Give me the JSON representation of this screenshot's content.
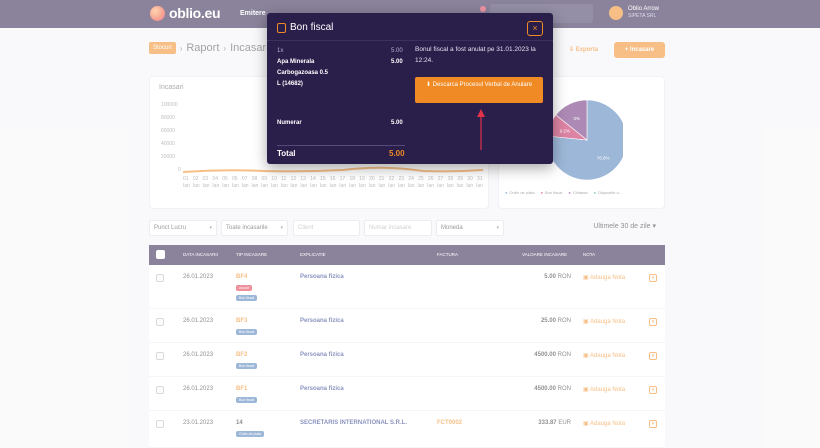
{
  "app": {
    "logo_text": "oblio.eu"
  },
  "nav": {
    "emitere": "Emitere"
  },
  "user": {
    "name": "Oblio Arrow",
    "company": "SIPETA SRL"
  },
  "breadcrumb": {
    "tag": "Stocuri",
    "items": [
      "Raport",
      "Incasari"
    ]
  },
  "toolbar": {
    "export_label": "Exporta",
    "add_label": "+ Incasare"
  },
  "chart_card": {
    "title": "Incasari"
  },
  "chart_data": [
    {
      "type": "area",
      "title": "Incasari",
      "y_ticks": [
        "100000",
        "80000",
        "60000",
        "40000",
        "20000",
        "0"
      ],
      "x_ticks": [
        "01",
        "02",
        "03",
        "04",
        "05",
        "06",
        "07",
        "08",
        "09",
        "10",
        "11",
        "12",
        "13",
        "14",
        "15",
        "16",
        "17",
        "18",
        "19",
        "20",
        "21",
        "22",
        "23",
        "24",
        "25",
        "26",
        "27",
        "28",
        "29",
        "30",
        "31"
      ],
      "x_subticks": [
        "Ian",
        "Ian",
        "Ian",
        "Ian",
        "Ian",
        "Ian",
        "Ian",
        "Ian",
        "Ian",
        "Ian",
        "Ian",
        "Ian",
        "Ian",
        "Ian",
        "Ian",
        "Ian",
        "Ian",
        "Ian",
        "Ian",
        "Ian",
        "Ian",
        "Ian",
        "Ian",
        "Ian",
        "Ian",
        "Ian",
        "Ian",
        "Ian",
        "Ian",
        "Ian",
        "Ian"
      ],
      "ylim": [
        0,
        100000
      ]
    },
    {
      "type": "pie",
      "slices": [
        {
          "label": "Ordin de plata",
          "value": 76.6,
          "color": "#4e7db8"
        },
        {
          "label": "Bon fiscal",
          "value": 9.2,
          "color": "#c2205a"
        },
        {
          "label": "Chitanta",
          "value": 14.2,
          "color": "#6b2a78"
        }
      ],
      "data_labels": [
        "76.6%",
        "9.2%",
        "3%"
      ],
      "legend": [
        "Ordin de plata",
        "Bon fiscal",
        "Chitanta",
        "Dispozitie d..."
      ]
    }
  ],
  "filters": {
    "punct_lucru": "Punct Lucru",
    "toate": "Toate incasarile",
    "client_placeholder": "Client",
    "numar_placeholder": "Numar incasare",
    "moneda": "Moneda",
    "period": "Ultimele 30 de zile"
  },
  "table": {
    "headers": [
      "DATA INCASARII",
      "TIP INCASARE",
      "EXPLICATIE",
      "FACTURA",
      "VALOARE INCASARE",
      "NOTA"
    ],
    "rows": [
      {
        "date": "26.01.2023",
        "type": "BF4",
        "badges": [
          "Anulat",
          "Bon fiscal"
        ],
        "explicatie": "Persoana fizica",
        "factura": "",
        "amount": "5.00",
        "currency": "RON",
        "nota": "Adauga Nota"
      },
      {
        "date": "26.01.2023",
        "type": "BF3",
        "badges": [
          "Bon fiscal"
        ],
        "explicatie": "Persoana fizica",
        "factura": "",
        "amount": "25.00",
        "currency": "RON",
        "nota": "Adauga Nota"
      },
      {
        "date": "26.01.2023",
        "type": "BF2",
        "badges": [
          "Bon fiscal"
        ],
        "explicatie": "Persoana fizica",
        "factura": "",
        "amount": "4500.00",
        "currency": "RON",
        "nota": "Adauga Nota"
      },
      {
        "date": "26.01.2023",
        "type": "BF1",
        "badges": [
          "Bon fiscal"
        ],
        "explicatie": "Persoana fizica",
        "factura": "",
        "amount": "4500.00",
        "currency": "RON",
        "nota": "Adauga Nota"
      },
      {
        "date": "23.01.2023",
        "type": "14",
        "badges": [
          "Ordin de plata"
        ],
        "explicatie": "SECRETARIS INTERNATIONAL S.R.L.",
        "factura": "FCT0002",
        "amount": "333.87",
        "currency": "EUR",
        "nota": "Adauga Nota"
      }
    ]
  },
  "modal": {
    "title": "Bon fiscal",
    "close": "×",
    "qty": "1x",
    "unit_price": "5.00",
    "item_name_lines": [
      "Apa Minerala",
      "Carbogazoasa 0.5",
      "L (14682)"
    ],
    "item_total": "5.00",
    "payment_label": "Numerar",
    "payment_value": "5.00",
    "total_label": "Total",
    "total_value": "5.00",
    "message": "Bonul fiscal a fost anulat pe 31.01.2023 la 12:24.",
    "button_label": "Descarca Procesul Verbal de Anulare"
  },
  "colors": {
    "accent": "#f08a24",
    "dark": "#2a1e4a",
    "danger": "#e0334a",
    "badge_blue": "#4e7db8"
  }
}
